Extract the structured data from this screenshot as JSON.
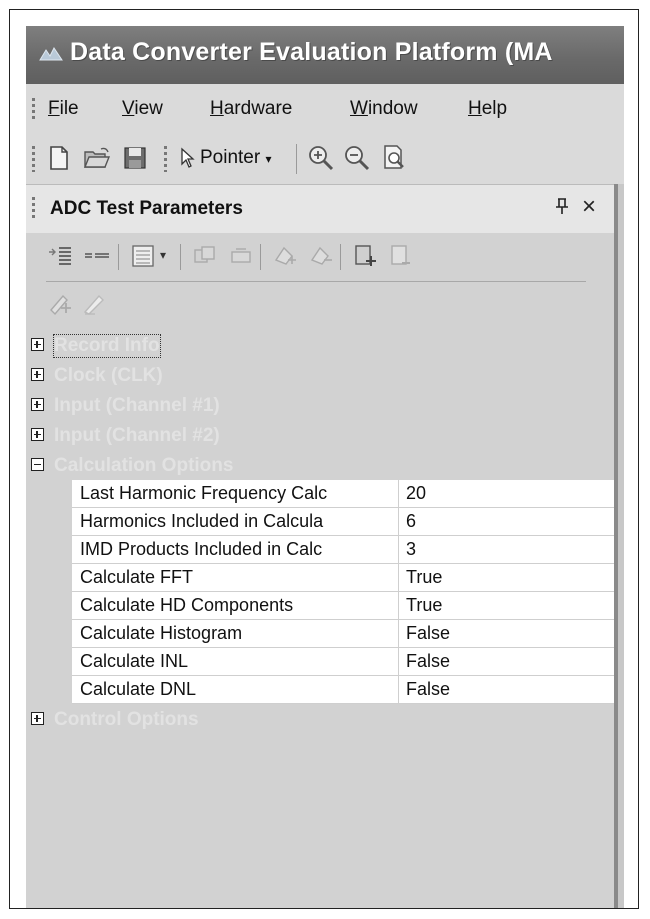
{
  "window": {
    "title": "Data Converter Evaluation Platform (MA"
  },
  "menu": [
    {
      "label": "File",
      "mnemonic": "F",
      "rest": "ile"
    },
    {
      "label": "View",
      "mnemonic": "V",
      "rest": "iew"
    },
    {
      "label": "Hardware",
      "mnemonic": "H",
      "rest": "ardware"
    },
    {
      "label": "Window",
      "mnemonic": "W",
      "rest": "indow"
    },
    {
      "label": "Help",
      "mnemonic": "H",
      "rest": "elp"
    }
  ],
  "toolbar": {
    "icons": [
      "new-file-icon",
      "open-folder-icon",
      "save-icon",
      "zoom-in-icon",
      "zoom-out-icon",
      "zoom-fit-icon"
    ],
    "pointer_label": "Pointer"
  },
  "panel": {
    "title": "ADC Test Parameters",
    "pin_glyph": "ᵖ",
    "close_glyph": "×"
  },
  "categories": [
    {
      "label": "Record Info",
      "expanded": false
    },
    {
      "label": "Clock (CLK)",
      "expanded": false
    },
    {
      "label": "Input (Channel #1)",
      "expanded": false
    },
    {
      "label": "Input (Channel #2)",
      "expanded": false
    },
    {
      "label": "Calculation Options",
      "expanded": true
    },
    {
      "label": "Control Options",
      "expanded": false
    }
  ],
  "properties": [
    {
      "name": "Last Harmonic Frequency Calc",
      "value": "20"
    },
    {
      "name": "Harmonics Included in Calcula",
      "value": "6"
    },
    {
      "name": "IMD Products Included in Calc",
      "value": "3"
    },
    {
      "name": "Calculate FFT",
      "value": "True"
    },
    {
      "name": "Calculate HD Components",
      "value": "True"
    },
    {
      "name": "Calculate Histogram",
      "value": "False"
    },
    {
      "name": "Calculate INL",
      "value": "False"
    },
    {
      "name": "Calculate DNL",
      "value": "False"
    }
  ]
}
